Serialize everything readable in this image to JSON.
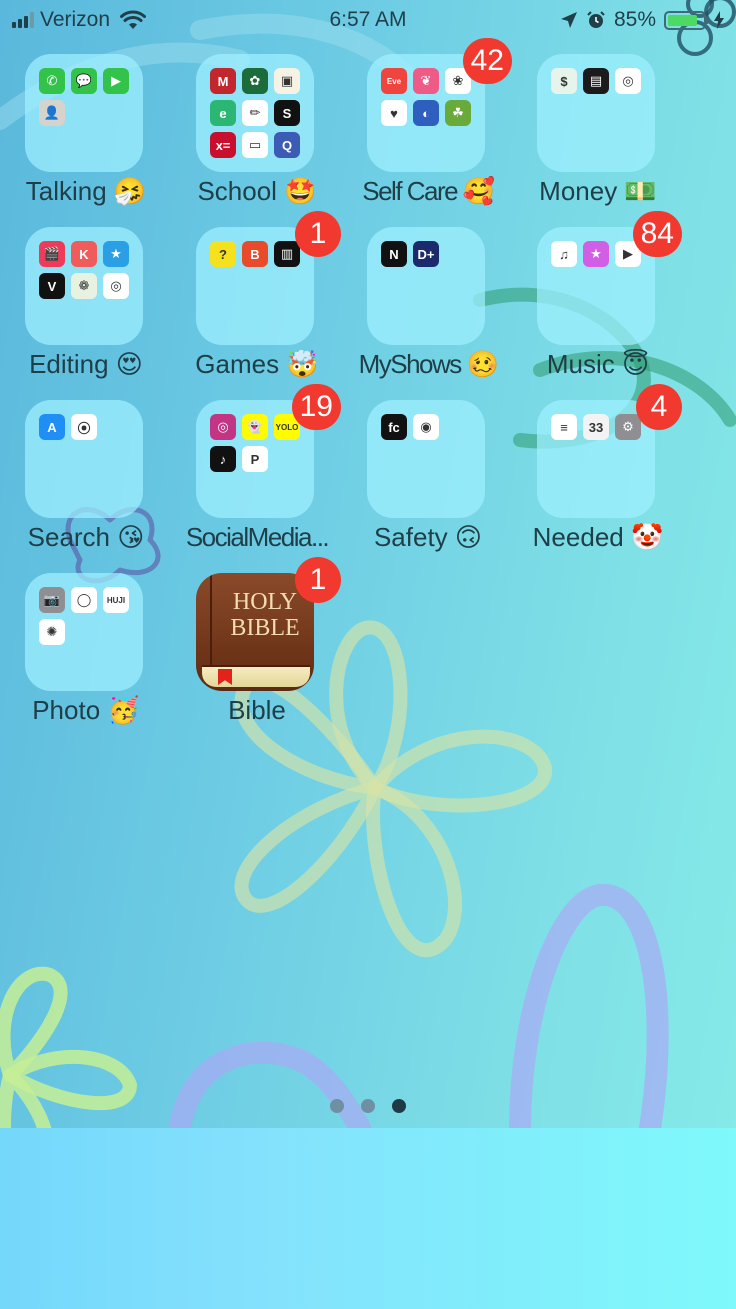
{
  "status_bar": {
    "carrier": "Verizon",
    "signal_bars": 3,
    "signal_bars_total": 4,
    "wifi_icon": "wifi-icon",
    "time": "6:57 AM",
    "location_icon": "location-arrow-icon",
    "alarm_icon": "alarm-icon",
    "battery_percent_label": "85%",
    "battery_level": 0.85,
    "charging_icon": "charging-bolt-icon"
  },
  "home_items": [
    {
      "type": "folder",
      "label": "Talking 🤧",
      "badge": null,
      "apps": [
        {
          "name": "Phone",
          "bg": "#33c34a",
          "glyph": "✆"
        },
        {
          "name": "Messages",
          "bg": "#33c34a",
          "glyph": "💬"
        },
        {
          "name": "FaceTime",
          "bg": "#33c34a",
          "glyph": "▶"
        },
        {
          "name": "Contacts",
          "bg": "#d6d2cc",
          "glyph": "👤"
        }
      ]
    },
    {
      "type": "folder",
      "label": "School 🤩",
      "badge": null,
      "apps": [
        {
          "name": "Mathway",
          "bg": "#c1272d",
          "glyph": "M"
        },
        {
          "name": "Pinwheel",
          "bg": "#1c6b3a",
          "glyph": "✿"
        },
        {
          "name": "Google Classroom",
          "bg": "#f6f2e4",
          "glyph": "▣"
        },
        {
          "name": "Edmentum",
          "bg": "#2bb673",
          "glyph": "e"
        },
        {
          "name": "Pencil App",
          "bg": "#ffffff",
          "glyph": "✏"
        },
        {
          "name": "Schoology",
          "bg": "#111111",
          "glyph": "S"
        },
        {
          "name": "Formula App",
          "bg": "#c8102e",
          "glyph": "x="
        },
        {
          "name": "Google Slides",
          "bg": "#ffffff",
          "glyph": "▭"
        },
        {
          "name": "Quizlet",
          "bg": "#3b5bb5",
          "glyph": "Q"
        }
      ]
    },
    {
      "type": "folder",
      "label": "Self Care 🥰",
      "badge": "42",
      "apps": [
        {
          "name": "Eve",
          "bg": "#f0453f",
          "glyph": "Eve"
        },
        {
          "name": "Flo",
          "bg": "#ee5b86",
          "glyph": "❦"
        },
        {
          "name": "Flower App",
          "bg": "#ffffff",
          "glyph": "❀"
        },
        {
          "name": "Health",
          "bg": "#ffffff",
          "glyph": "♥"
        },
        {
          "name": "Calm App",
          "bg": "#2f5fbe",
          "glyph": "◐"
        },
        {
          "name": "Plant Nanny",
          "bg": "#6aaa3a",
          "glyph": "☘"
        }
      ]
    },
    {
      "type": "folder",
      "label": "Money 💵",
      "badge": null,
      "apps": [
        {
          "name": "Cash App",
          "bg": "#e6f4ec",
          "glyph": "$"
        },
        {
          "name": "Wallet",
          "bg": "#1b1b1b",
          "glyph": "▤"
        },
        {
          "name": "Target",
          "bg": "#ffffff",
          "glyph": "◎"
        }
      ]
    },
    {
      "type": "folder",
      "label": "Editing 😍",
      "badge": null,
      "apps": [
        {
          "name": "Video Editor",
          "bg": "#ef3b5a",
          "glyph": "🎬"
        },
        {
          "name": "KineMaster",
          "bg": "#f05b5b",
          "glyph": "K"
        },
        {
          "name": "Video Star",
          "bg": "#2b9fe6",
          "glyph": "★"
        },
        {
          "name": "Vont",
          "bg": "#111111",
          "glyph": "V"
        },
        {
          "name": "Pic Collage",
          "bg": "#e8f2e0",
          "glyph": "❁"
        },
        {
          "name": "Spiral App",
          "bg": "#ffffff",
          "glyph": "◎"
        }
      ]
    },
    {
      "type": "folder",
      "label": "Games 🤯",
      "badge": "1",
      "apps": [
        {
          "name": "Meme Game",
          "bg": "#f6e11e",
          "glyph": "?"
        },
        {
          "name": "BitLife",
          "bg": "#e84a2a",
          "glyph": "B"
        },
        {
          "name": "Piano",
          "bg": "#111111",
          "glyph": "▥"
        }
      ]
    },
    {
      "type": "folder",
      "label": "MyShows 🥴",
      "badge": null,
      "apps": [
        {
          "name": "Netflix",
          "bg": "#111111",
          "glyph": "N"
        },
        {
          "name": "Disney+",
          "bg": "#1a2a6c",
          "glyph": "D+"
        }
      ]
    },
    {
      "type": "folder",
      "label": "Music 😇",
      "badge": "84",
      "apps": [
        {
          "name": "Music",
          "bg": "#ffffff",
          "glyph": "♫"
        },
        {
          "name": "iTunes Store",
          "bg": "#d35ee6",
          "glyph": "★"
        },
        {
          "name": "YouTube",
          "bg": "#ffffff",
          "glyph": "▶"
        }
      ]
    },
    {
      "type": "folder",
      "label": "Search 😘",
      "badge": null,
      "apps": [
        {
          "name": "App Store",
          "bg": "#1f8ff5",
          "glyph": "A"
        },
        {
          "name": "Safari",
          "bg": "#ffffff",
          "glyph": "⦿"
        }
      ]
    },
    {
      "type": "folder",
      "label": "SocialMedia...",
      "badge": "19",
      "apps": [
        {
          "name": "Instagram",
          "bg": "#c13584",
          "glyph": "◎"
        },
        {
          "name": "Snapchat",
          "bg": "#fffc00",
          "glyph": "👻"
        },
        {
          "name": "YOLO",
          "bg": "#fffc00",
          "glyph": "YOLO"
        },
        {
          "name": "TikTok",
          "bg": "#111111",
          "glyph": "♪"
        },
        {
          "name": "Pinterest",
          "bg": "#ffffff",
          "glyph": "P"
        }
      ]
    },
    {
      "type": "folder",
      "label": "Safety 🙃",
      "badge": null,
      "apps": [
        {
          "name": "FamilyChild",
          "bg": "#111111",
          "glyph": "fc"
        },
        {
          "name": "Find My",
          "bg": "#ffffff",
          "glyph": "◉"
        }
      ]
    },
    {
      "type": "folder",
      "label": "Needed 🤡",
      "badge": "4",
      "apps": [
        {
          "name": "Notes",
          "bg": "#ffffff",
          "glyph": "≡"
        },
        {
          "name": "Countdown App",
          "bg": "#f3f3f3",
          "glyph": "33"
        },
        {
          "name": "Settings",
          "bg": "#8e8e93",
          "glyph": "⚙"
        }
      ]
    },
    {
      "type": "folder",
      "label": "Photo 🥳",
      "badge": null,
      "apps": [
        {
          "name": "Camera",
          "bg": "#8e8e93",
          "glyph": "📷"
        },
        {
          "name": "Film Camera",
          "bg": "#ffffff",
          "glyph": "◯"
        },
        {
          "name": "Huji",
          "bg": "#ffffff",
          "glyph": "HUJI"
        },
        {
          "name": "Photos",
          "bg": "#ffffff",
          "glyph": "✺"
        }
      ]
    },
    {
      "type": "app",
      "label": "Bible",
      "badge": "1",
      "icon_text_line1": "HOLY",
      "icon_text_line2": "BIBLE"
    }
  ],
  "page_indicator": {
    "pages": 3,
    "current": 3
  },
  "colors": {
    "badge": "#f2392f",
    "label_text": "#1e3e48",
    "folder_bg": "#a0f0ff",
    "battery_fill": "#4cd964"
  }
}
